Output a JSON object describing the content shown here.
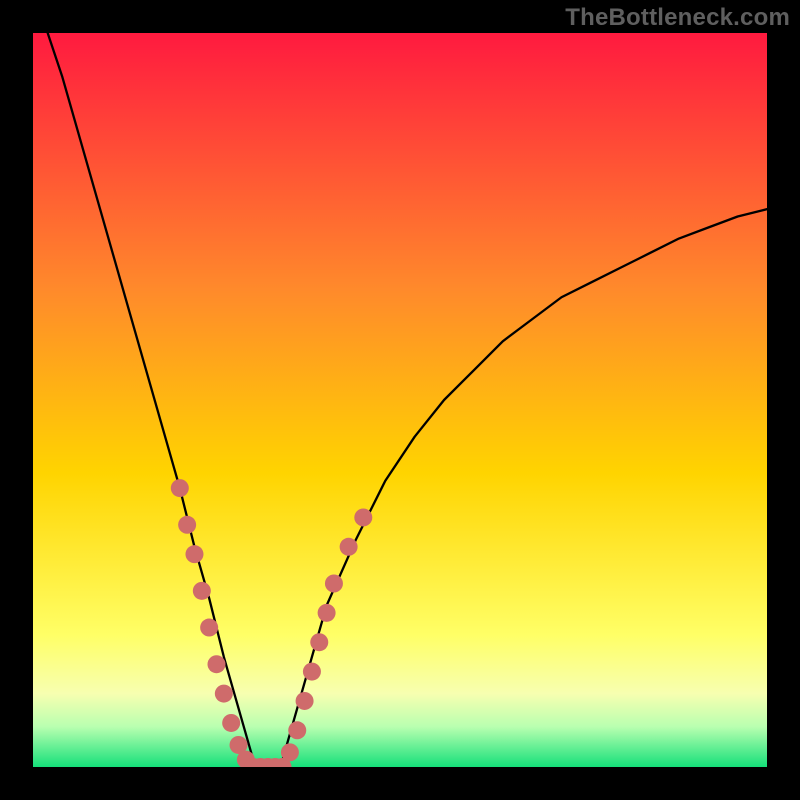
{
  "watermark": "TheBottleneck.com",
  "colors": {
    "background": "#000000",
    "gradient_top": "#ff1a3f",
    "gradient_mid_upper": "#ff8a2b",
    "gradient_mid": "#ffd400",
    "gradient_lower": "#ffff66",
    "gradient_pale": "#f7ffb0",
    "gradient_green_light": "#b9ffb0",
    "gradient_green": "#15e07a",
    "curve": "#000000",
    "marker": "#cf6b6b"
  },
  "chart_data": {
    "type": "line",
    "title": "",
    "xlabel": "",
    "ylabel": "",
    "xlim": [
      0,
      100
    ],
    "ylim": [
      0,
      100
    ],
    "grid": false,
    "legend": false,
    "series": [
      {
        "name": "bottleneck-curve",
        "x": [
          0,
          2,
          4,
          6,
          8,
          10,
          12,
          14,
          16,
          18,
          20,
          22,
          24,
          26,
          28,
          30,
          31,
          32,
          33,
          34,
          36,
          38,
          40,
          44,
          48,
          52,
          56,
          60,
          64,
          68,
          72,
          76,
          80,
          84,
          88,
          92,
          96,
          100
        ],
        "y": [
          null,
          100,
          94,
          87,
          80,
          73,
          66,
          59,
          52,
          45,
          38,
          30,
          23,
          15,
          8,
          1,
          0,
          0,
          0,
          1,
          8,
          15,
          22,
          31,
          39,
          45,
          50,
          54,
          58,
          61,
          64,
          66,
          68,
          70,
          72,
          73.5,
          75,
          76
        ]
      }
    ],
    "markers": [
      {
        "name": "left-cluster",
        "points": [
          [
            20,
            38
          ],
          [
            21,
            33
          ],
          [
            22,
            29
          ],
          [
            23,
            24
          ],
          [
            24,
            19
          ],
          [
            25,
            14
          ],
          [
            26,
            10
          ],
          [
            27,
            6
          ],
          [
            28,
            3
          ],
          [
            29,
            1
          ]
        ]
      },
      {
        "name": "valley",
        "points": [
          [
            30,
            0
          ],
          [
            31,
            0
          ],
          [
            32,
            0
          ],
          [
            33,
            0
          ],
          [
            34,
            0
          ]
        ]
      },
      {
        "name": "right-cluster",
        "points": [
          [
            35,
            2
          ],
          [
            36,
            5
          ],
          [
            37,
            9
          ],
          [
            38,
            13
          ],
          [
            39,
            17
          ],
          [
            40,
            21
          ],
          [
            41,
            25
          ],
          [
            43,
            30
          ],
          [
            45,
            34
          ]
        ]
      }
    ],
    "gradient_stops": [
      {
        "offset": 0.0,
        "color_key": "gradient_top"
      },
      {
        "offset": 0.35,
        "color_key": "gradient_mid_upper"
      },
      {
        "offset": 0.6,
        "color_key": "gradient_mid"
      },
      {
        "offset": 0.82,
        "color_key": "gradient_lower"
      },
      {
        "offset": 0.9,
        "color_key": "gradient_pale"
      },
      {
        "offset": 0.945,
        "color_key": "gradient_green_light"
      },
      {
        "offset": 1.0,
        "color_key": "gradient_green"
      }
    ]
  }
}
